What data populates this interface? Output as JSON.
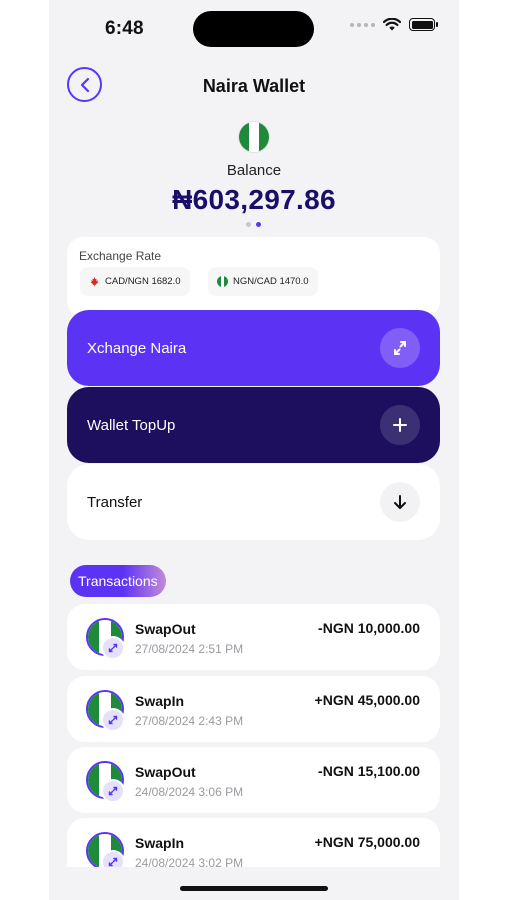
{
  "status_bar": {
    "time": "6:48"
  },
  "header": {
    "title": "Naira Wallet"
  },
  "balance": {
    "label": "Balance",
    "amount": "₦603,297.86"
  },
  "exchange": {
    "title": "Exchange Rate",
    "rates": [
      {
        "label": "CAD/NGN 1682.0",
        "flag": "canada-flag"
      },
      {
        "label": "NGN/CAD 1470.0",
        "flag": "nigeria-flag"
      }
    ]
  },
  "actions": {
    "xchange": "Xchange Naira",
    "topup": "Wallet TopUp",
    "transfer": "Transfer"
  },
  "transactions": {
    "title": "Transactions",
    "items": [
      {
        "type": "SwapOut",
        "date": "27/08/2024 2:51 PM",
        "amount": "-NGN 10,000.00"
      },
      {
        "type": "SwapIn",
        "date": "27/08/2024 2:43 PM",
        "amount": "+NGN 45,000.00"
      },
      {
        "type": "SwapOut",
        "date": "24/08/2024 3:06 PM",
        "amount": "-NGN 15,100.00"
      },
      {
        "type": "SwapIn",
        "date": "24/08/2024 3:02 PM",
        "amount": "+NGN 75,000.00"
      }
    ]
  },
  "colors": {
    "accent": "#5b33f4",
    "dark_accent": "#1d0f5e",
    "balance_text": "#1b0e6b",
    "nigeria_green": "#1f8a3b"
  }
}
